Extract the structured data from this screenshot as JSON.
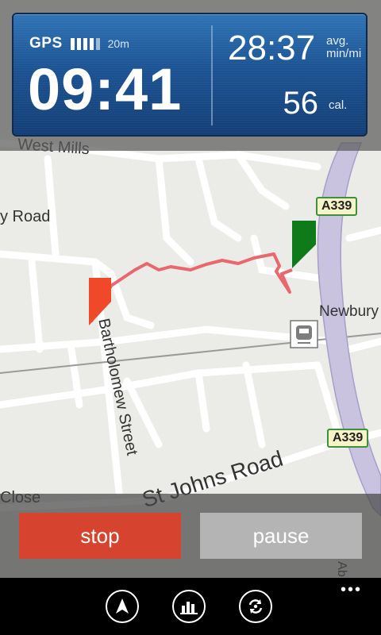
{
  "stats": {
    "gps_label": "GPS",
    "gps_signal_bars": 4,
    "gps_accuracy": "20m",
    "elapsed_time": "09:41",
    "pace": "28:37",
    "pace_unit_line1": "avg.",
    "pace_unit_line2": "min/mi",
    "calories": "56",
    "calories_unit": "cal."
  },
  "map": {
    "labels": {
      "west_mills": "West Mills",
      "road_left": "y Road",
      "newbury": "Newbury",
      "bartholomew": "Bartholomew Street",
      "st_johns": "St Johns Road",
      "close": "Close",
      "a339_top": "A339",
      "a339_bottom": "A339",
      "ab_fragment": "Ab"
    },
    "route_color": "#e8686e",
    "start_flag_color": "#0f7a1a",
    "end_flag_color": "#f0492a"
  },
  "controls": {
    "stop_label": "stop",
    "pause_label": "pause",
    "stop_color": "#d6432f",
    "pause_color": "#b4b4b4"
  },
  "appbar": {
    "buttons": [
      "navigation-arrow-icon",
      "stats-chart-icon",
      "rotate-map-icon"
    ],
    "more_label": "•••"
  }
}
